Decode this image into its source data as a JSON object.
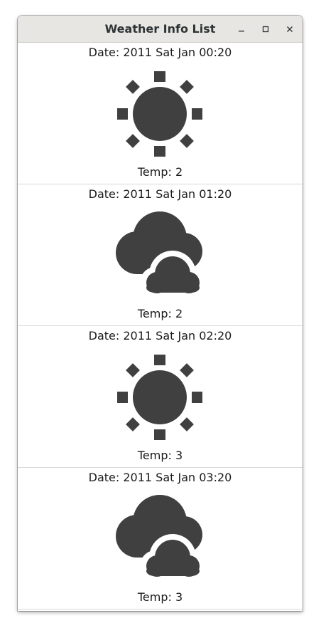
{
  "window": {
    "title": "Weather Info List"
  },
  "items": [
    {
      "date": "Date: 2011 Sat Jan 00:20",
      "icon": "sun-icon",
      "temp": "Temp: 2"
    },
    {
      "date": "Date: 2011 Sat Jan 01:20",
      "icon": "cloudy-icon",
      "temp": "Temp: 2"
    },
    {
      "date": "Date: 2011 Sat Jan 02:20",
      "icon": "sun-icon",
      "temp": "Temp: 3"
    },
    {
      "date": "Date: 2011 Sat Jan 03:20",
      "icon": "cloudy-icon",
      "temp": "Temp: 3"
    }
  ],
  "colors": {
    "icon": "#404040",
    "titlebar": "#e8e6e3"
  }
}
